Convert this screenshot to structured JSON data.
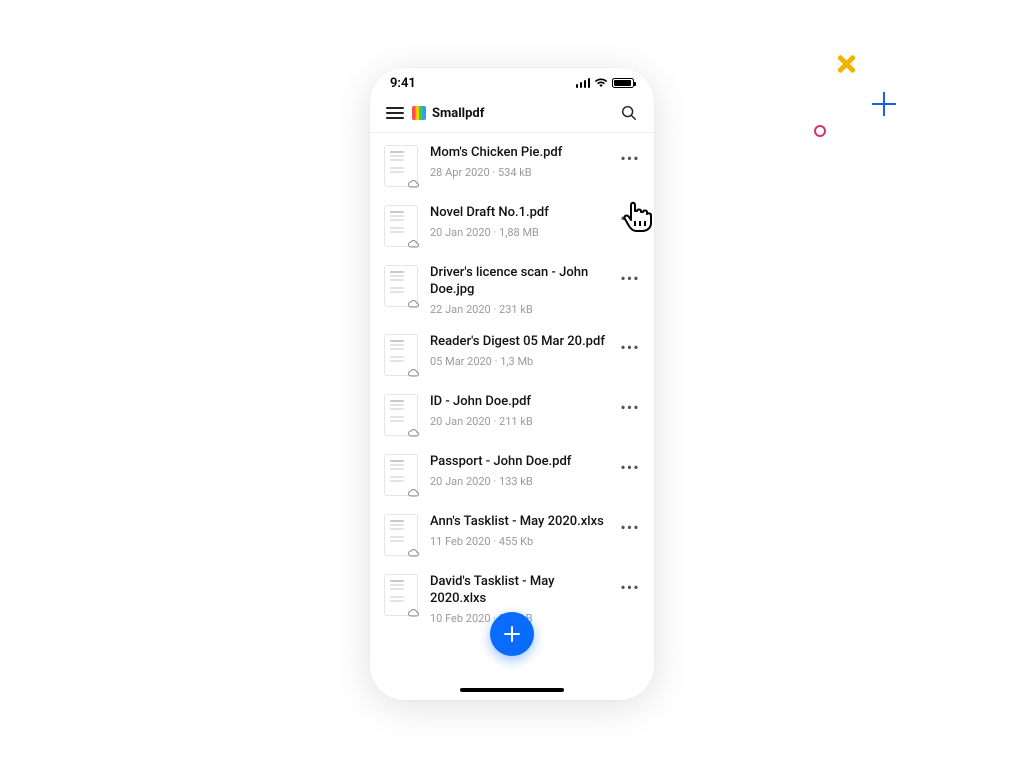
{
  "statusbar": {
    "time": "9:41"
  },
  "header": {
    "brand": "Smallpdf"
  },
  "files": [
    {
      "name": "Mom's Chicken Pie.pdf",
      "meta": "28 Apr 2020 · 534 kB"
    },
    {
      "name": "Novel Draft No.1.pdf",
      "meta": "20 Jan 2020 · 1,88 MB"
    },
    {
      "name": "Driver's licence scan - John Doe.jpg",
      "meta": "22 Jan 2020 · 231 kB"
    },
    {
      "name": "Reader's Digest 05 Mar 20.pdf",
      "meta": "05 Mar 2020 · 1,3 Mb"
    },
    {
      "name": "ID - John Doe.pdf",
      "meta": "20 Jan 2020 · 211 kB"
    },
    {
      "name": "Passport - John Doe.pdf",
      "meta": "20 Jan 2020 · 133 kB"
    },
    {
      "name": "Ann's Tasklist - May 2020.xlxs",
      "meta": "11 Feb 2020 · 455 Kb"
    },
    {
      "name": "David's Tasklist - May 2020.xlxs",
      "meta": "10 Feb 2020 · 345 kB"
    }
  ]
}
